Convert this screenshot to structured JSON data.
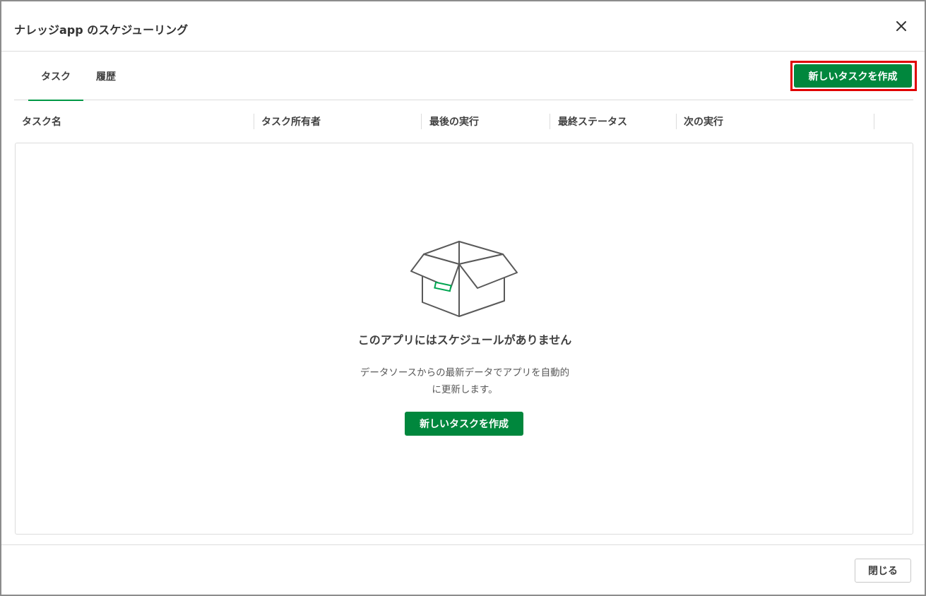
{
  "dialog": {
    "title": "ナレッジapp のスケジューリング",
    "close_icon": "close-icon"
  },
  "tabs": [
    {
      "label": "タスク",
      "active": true
    },
    {
      "label": "履歴",
      "active": false
    }
  ],
  "toolbar": {
    "create_task_label": "新しいタスクを作成",
    "highlight_color": "#e00000"
  },
  "table": {
    "columns": [
      "タスク名",
      "タスク所有者",
      "最後の実行",
      "最終ステータス",
      "次の実行"
    ]
  },
  "empty_state": {
    "icon": "open-box-icon",
    "title": "このアプリにはスケジュールがありません",
    "description": "データソースからの最新データでアプリを自動的に更新します。",
    "create_task_label": "新しいタスクを作成"
  },
  "footer": {
    "close_label": "閉じる"
  },
  "colors": {
    "accent_green": "#00873d",
    "tab_underline": "#009845"
  }
}
